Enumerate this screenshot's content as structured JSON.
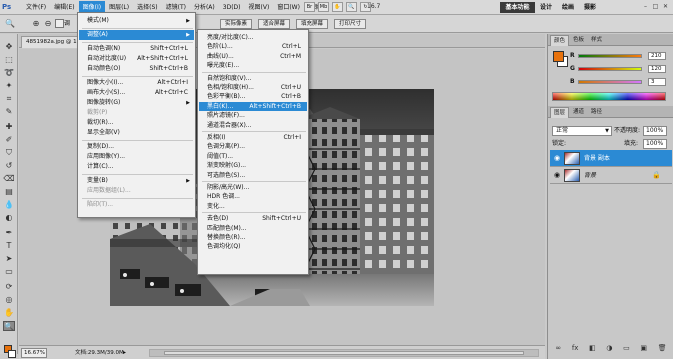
{
  "app": {
    "logo": "Ps"
  },
  "menubar": {
    "items": [
      "文件(F)",
      "编辑(E)",
      "图像(I)",
      "图层(L)",
      "选择(S)",
      "滤镜(T)",
      "分析(A)",
      "3D(D)",
      "视图(V)",
      "窗口(W)",
      "帮助(H)"
    ],
    "active_index": 2,
    "zoom": "16.7",
    "workspace_button": "基本功能",
    "workspace_links": [
      "设计",
      "绘画",
      "摄影"
    ]
  },
  "options_bar": {
    "checkbox_label": "调",
    "buttons": [
      "实际像素",
      "适合屏幕",
      "填充屏幕",
      "打印尺寸"
    ]
  },
  "document": {
    "tab_title": "4851982a.jpg @ 16",
    "zoom_field": "16.67%",
    "doc_info": "文档:29.3M/39.0M"
  },
  "image_menu": {
    "items": [
      {
        "label": "模式(M)",
        "shortcut": "",
        "submenu": true,
        "disabled": false
      },
      {
        "sep": true
      },
      {
        "label": "调整(A)",
        "shortcut": "",
        "submenu": true,
        "disabled": false,
        "highlight": true
      },
      {
        "sep": true
      },
      {
        "label": "自动色调(N)",
        "shortcut": "Shift+Ctrl+L",
        "disabled": false
      },
      {
        "label": "自动对比度(U)",
        "shortcut": "Alt+Shift+Ctrl+L",
        "disabled": false
      },
      {
        "label": "自动颜色(O)",
        "shortcut": "Shift+Ctrl+B",
        "disabled": false
      },
      {
        "sep": true
      },
      {
        "label": "图像大小(I)...",
        "shortcut": "Alt+Ctrl+I",
        "disabled": false
      },
      {
        "label": "画布大小(S)...",
        "shortcut": "Alt+Ctrl+C",
        "disabled": false
      },
      {
        "label": "图像旋转(G)",
        "shortcut": "",
        "submenu": true,
        "disabled": false
      },
      {
        "label": "裁剪(P)",
        "shortcut": "",
        "disabled": true
      },
      {
        "label": "裁切(R)...",
        "shortcut": "",
        "disabled": false
      },
      {
        "label": "显示全部(V)",
        "shortcut": "",
        "disabled": false
      },
      {
        "sep": true
      },
      {
        "label": "复制(D)...",
        "shortcut": "",
        "disabled": false
      },
      {
        "label": "应用图像(Y)...",
        "shortcut": "",
        "disabled": false
      },
      {
        "label": "计算(C)...",
        "shortcut": "",
        "disabled": false
      },
      {
        "sep": true
      },
      {
        "label": "变量(B)",
        "shortcut": "",
        "submenu": true,
        "disabled": false
      },
      {
        "label": "应用数据组(L)...",
        "shortcut": "",
        "disabled": true
      },
      {
        "sep": true
      },
      {
        "label": "陷印(T)...",
        "shortcut": "",
        "disabled": true
      }
    ]
  },
  "adjust_menu": {
    "items": [
      {
        "label": "亮度/对比度(C)...",
        "shortcut": ""
      },
      {
        "label": "色阶(L)...",
        "shortcut": "Ctrl+L"
      },
      {
        "label": "曲线(U)...",
        "shortcut": "Ctrl+M"
      },
      {
        "label": "曝光度(E)...",
        "shortcut": ""
      },
      {
        "sep": true
      },
      {
        "label": "自然饱和度(V)...",
        "shortcut": ""
      },
      {
        "label": "色相/饱和度(H)...",
        "shortcut": "Ctrl+U"
      },
      {
        "label": "色彩平衡(B)...",
        "shortcut": "Ctrl+B"
      },
      {
        "label": "黑白(K)...",
        "shortcut": "Alt+Shift+Ctrl+B",
        "highlight": true
      },
      {
        "label": "照片滤镜(F)...",
        "shortcut": ""
      },
      {
        "label": "通道混合器(X)...",
        "shortcut": ""
      },
      {
        "sep": true
      },
      {
        "label": "反相(I)",
        "shortcut": "Ctrl+I"
      },
      {
        "label": "色调分离(P)...",
        "shortcut": ""
      },
      {
        "label": "阈值(T)...",
        "shortcut": ""
      },
      {
        "label": "渐变映射(G)...",
        "shortcut": ""
      },
      {
        "label": "可选颜色(S)...",
        "shortcut": ""
      },
      {
        "sep": true
      },
      {
        "label": "阴影/高光(W)...",
        "shortcut": ""
      },
      {
        "label": "HDR 色调...",
        "shortcut": ""
      },
      {
        "label": "变化...",
        "shortcut": ""
      },
      {
        "sep": true
      },
      {
        "label": "去色(D)",
        "shortcut": "Shift+Ctrl+U"
      },
      {
        "label": "匹配颜色(M)...",
        "shortcut": ""
      },
      {
        "label": "替换颜色(R)...",
        "shortcut": ""
      },
      {
        "label": "色调均化(Q)",
        "shortcut": ""
      }
    ]
  },
  "color_panel": {
    "tabs": [
      "颜色",
      "色板",
      "样式"
    ],
    "channels": [
      {
        "letter": "R",
        "value": "210"
      },
      {
        "letter": "G",
        "value": "120"
      },
      {
        "letter": "B",
        "value": "3"
      }
    ],
    "foreground": "#e8720c"
  },
  "layers_panel": {
    "tabs": [
      "图层",
      "通道",
      "路径"
    ],
    "blend_mode": "正常",
    "opacity_label": "不透明度:",
    "opacity": "100%",
    "lock_label": "锁定:",
    "fill_label": "填充:",
    "fill": "100%",
    "layers": [
      {
        "name": "背景 副本",
        "selected": true,
        "locked": false
      },
      {
        "name": "背景",
        "selected": false,
        "locked": true
      }
    ]
  },
  "colors": {
    "accent": "#2b8ad4",
    "menu_bg": "#f1f1f1",
    "chrome": "#cacaca"
  }
}
